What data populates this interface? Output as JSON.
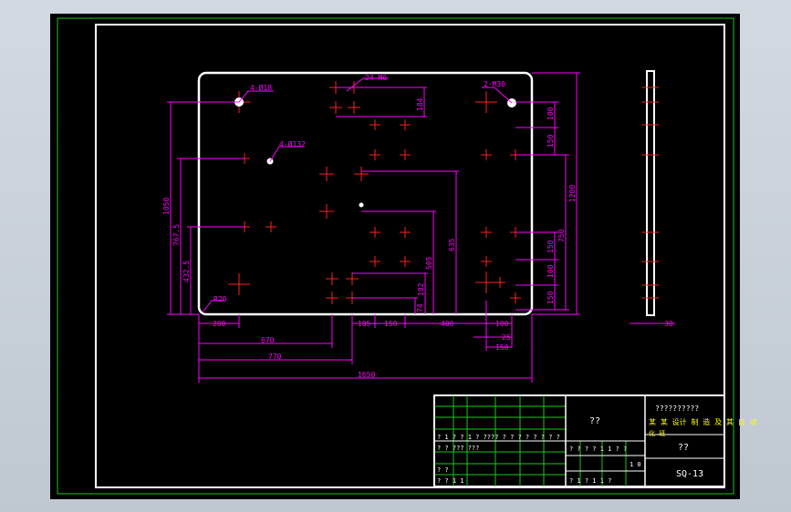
{
  "drawing": {
    "hole_callouts": {
      "top_left": "4-Ø18",
      "top_middle": "24-M6",
      "top_right": "2-M30",
      "middle_left": "4-Ø132",
      "bottom_left_radius": "R20"
    },
    "dims_horizontal": {
      "d200": "200",
      "d670": "670",
      "d770": "770",
      "d1650": "1650",
      "d105": "105",
      "d150a": "150",
      "d400": "400",
      "d100": "100",
      "d25": "25",
      "d150b": "150",
      "d30": "30"
    },
    "dims_vertical": {
      "d1050": "1050",
      "d767_5": "767.5",
      "d432_5": "432.5",
      "d184": "184",
      "d635": "635",
      "d505": "505",
      "d102": "102",
      "d74": "74",
      "d100r": "100",
      "d150r1": "150",
      "d1200": "1200",
      "d150r2": "150",
      "d750": "750",
      "d100r2": "100",
      "d150r3": "150"
    },
    "title_block": {
      "material_cell": "??",
      "school_line1": "??????????",
      "school_line2": "某 某 设计 制 造 及 其 自 动",
      "school_line3": "化 班",
      "part_name": "??",
      "drawing_no": "SQ-13",
      "row_a": "? ? ? ?   1 1   ? ?",
      "row_b": "1 0",
      "row_c": "? 1   ? 1 1   ?",
      "left_row1": "? 1 ? ?   1   ? ????   ? ?   ? ? ?   ? ? ?",
      "left_row2": "? ?   ???         ???",
      "left_row3": "? ?",
      "left_row4": "? ?               1 1"
    }
  }
}
